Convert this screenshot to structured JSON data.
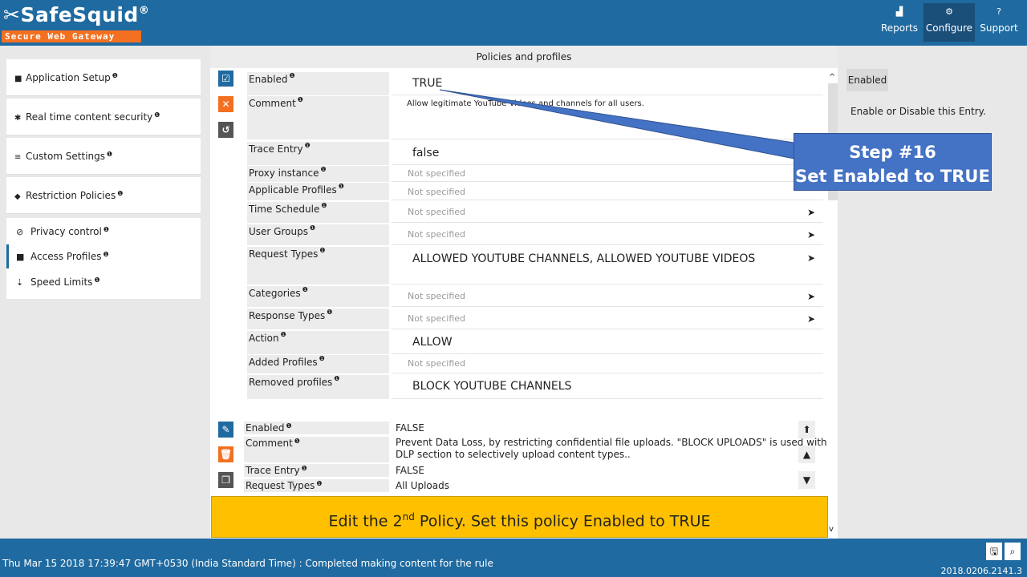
{
  "app": {
    "brand": "SafeSquid",
    "tagline": "Secure Web Gateway"
  },
  "nav": {
    "reports": "Reports",
    "configure": "Configure",
    "support": "Support"
  },
  "sidebar": {
    "items": [
      {
        "label": "Application Setup",
        "icon": "briefcase-icon"
      },
      {
        "label": "Real time content security",
        "icon": "bug-icon"
      },
      {
        "label": "Custom Settings",
        "icon": "sliders-icon"
      },
      {
        "label": "Restriction Policies",
        "icon": "shield-icon"
      }
    ],
    "subitems": [
      {
        "label": "Privacy control",
        "icon": "ban-icon"
      },
      {
        "label": "Access Profiles",
        "icon": "briefcase-icon"
      },
      {
        "label": "Speed Limits",
        "icon": "speed-icon"
      }
    ],
    "info": "❶"
  },
  "main": {
    "title": "Policies and profiles",
    "policy1": {
      "enabled_label": "Enabled",
      "enabled_value": "TRUE",
      "comment_label": "Comment",
      "comment_value": "Allow legitimate YouTube Videos and channels for all users.",
      "trace_label": "Trace Entry",
      "trace_value": "false",
      "proxy_label": "Proxy instance",
      "proxy_value": "Not specified",
      "profiles_label": "Applicable Profiles",
      "profiles_value": "Not specified",
      "schedule_label": "Time Schedule",
      "schedule_value": "Not specified",
      "groups_label": "User Groups",
      "groups_value": "Not specified",
      "request_label": "Request Types",
      "request_value": "ALLOWED YOUTUBE CHANNELS,   ALLOWED YOUTUBE VIDEOS",
      "categories_label": "Categories",
      "categories_value": "Not specified",
      "response_label": "Response Types",
      "response_value": "Not specified",
      "action_label": "Action",
      "action_value": "ALLOW",
      "added_label": "Added Profiles",
      "added_value": "Not specified",
      "removed_label": "Removed profiles",
      "removed_value": "BLOCK YOUTUBE CHANNELS"
    },
    "policy2": {
      "enabled_label": "Enabled",
      "enabled_value": "FALSE",
      "comment_label": "Comment",
      "comment_value_line1": "Prevent Data Loss, by restricting confidential file uploads. \"BLOCK UPLOADS\" is used with",
      "comment_value_line2": "DLP section to selectively  upload content types..",
      "trace_label": "Trace Entry",
      "trace_value": "FALSE",
      "request_label": "Request Types",
      "request_value": "All Uploads"
    }
  },
  "right": {
    "chip": "Enabled",
    "description": "Enable or Disable this Entry."
  },
  "callouts": {
    "step_line1": "Step #16",
    "step_line2": "Set Enabled to TRUE",
    "note_pre": "Edit the 2",
    "note_sup": "nd",
    "note_post": " Policy. Set this policy Enabled to TRUE"
  },
  "footer": {
    "status": "Thu Mar 15 2018 17:39:47 GMT+0530 (India Standard Time) : Completed making content for the rule",
    "version": "2018.0206.2141.3"
  },
  "colors": {
    "header": "#1f6aa0",
    "accent_orange": "#f37021",
    "callout_blue": "#4472c4",
    "note_yellow": "#ffc000"
  }
}
